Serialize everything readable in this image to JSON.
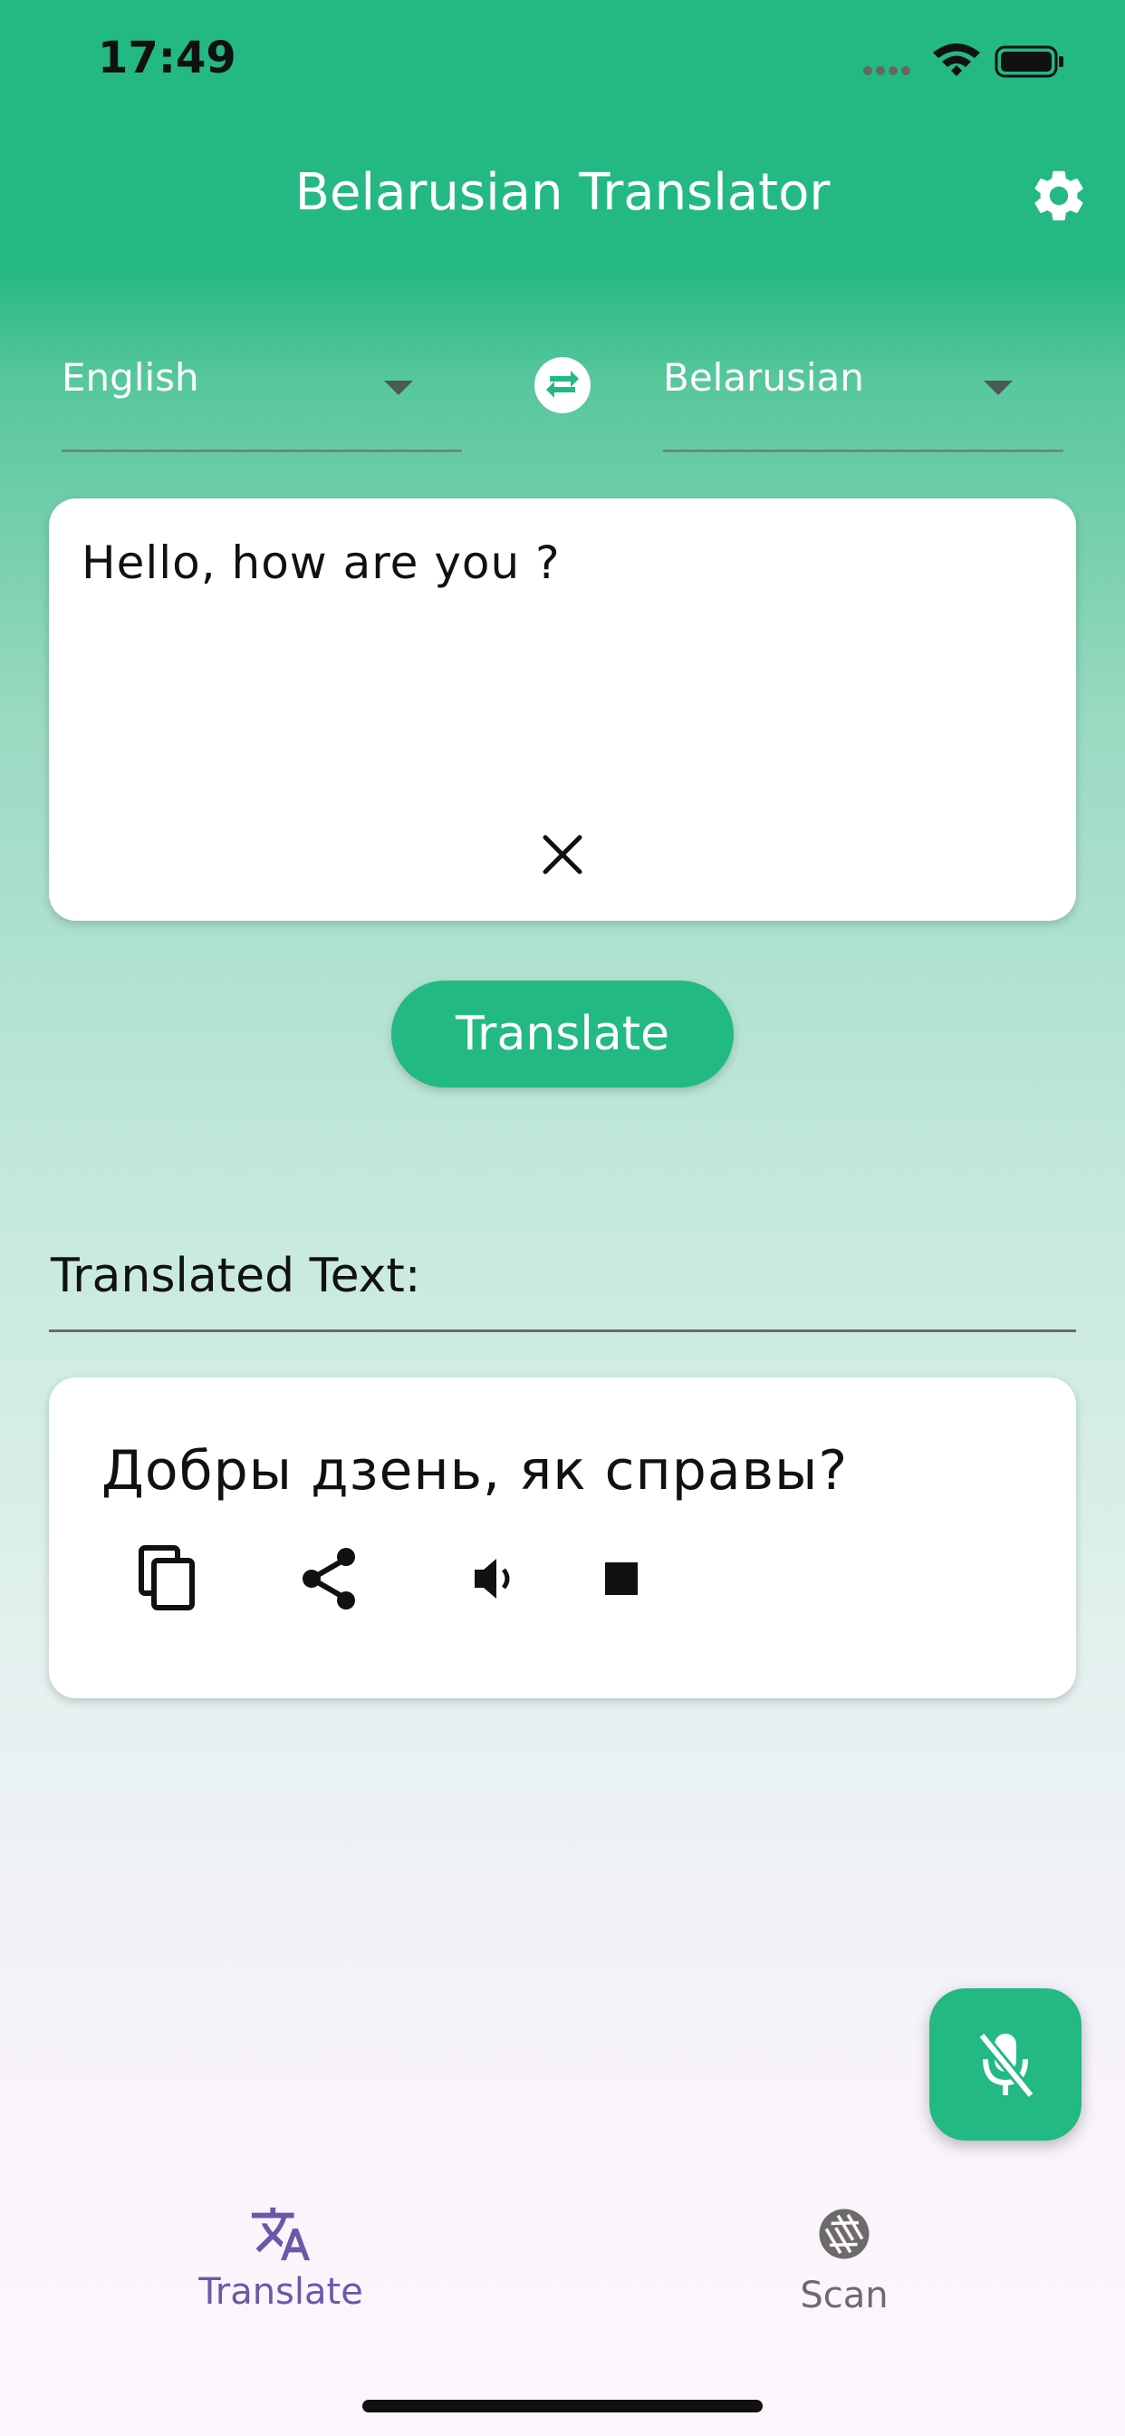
{
  "status_bar": {
    "time": "17:49"
  },
  "header": {
    "title": "Belarusian Translator"
  },
  "languages": {
    "source": "English",
    "target": "Belarusian"
  },
  "input": {
    "text": "Hello, how are you ?"
  },
  "actions": {
    "translate_label": "Translate"
  },
  "output": {
    "section_label": "Translated Text:",
    "text": "Добры дзень, як справы?"
  },
  "bottom_nav": {
    "items": [
      {
        "label": "Translate",
        "icon": "translate-icon",
        "active": true
      },
      {
        "label": "Scan",
        "icon": "camera-aperture-icon",
        "active": false
      }
    ]
  },
  "colors": {
    "accent": "#23b982",
    "nav_active": "#6a58a8",
    "nav_inactive": "#6b6b6b"
  }
}
